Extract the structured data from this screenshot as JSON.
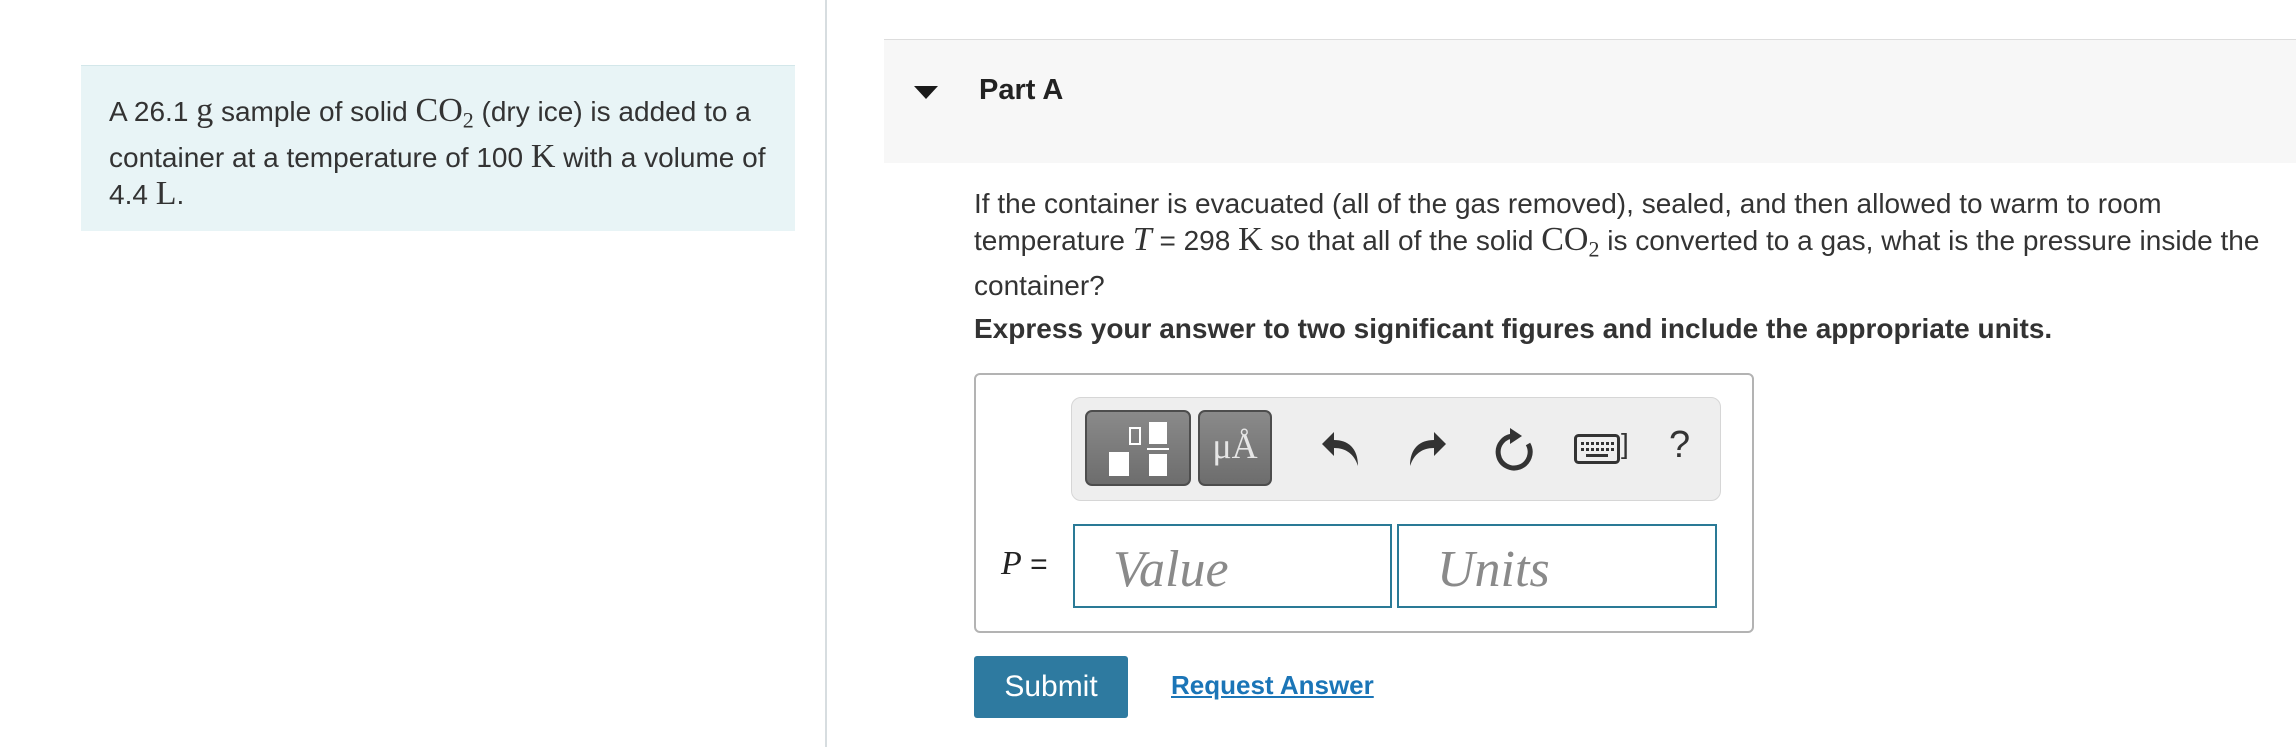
{
  "intro": {
    "t1": "A 26.1 ",
    "mass_unit": "g",
    "t2": " sample of solid ",
    "co2_base": "CO",
    "co2_sub": "2",
    "t3": " (dry ice) is added to a container at a temperature of 100 ",
    "temp_unit": "K",
    "t4": " with a volume of 4.4 ",
    "vol_unit": "L",
    "t5": "."
  },
  "part": {
    "title": "Part A"
  },
  "question": {
    "q1": "If the container is evacuated (all of the gas removed), sealed, and then allowed to warm to room temperature ",
    "T_var": "T",
    "q2": " = 298 ",
    "K_unit": "K",
    "q3": " so that all of the solid ",
    "co2_base": "CO",
    "co2_sub": "2",
    "q4": " is converted to a gas, what is the pressure inside the container?"
  },
  "instruction": "Express your answer to two significant figures and include the appropriate units.",
  "toolbar": {
    "units_symbol": "μÅ",
    "help": "?",
    "kbd_bracket": "]"
  },
  "answer": {
    "var": "P",
    "eq": " =",
    "value_placeholder": "Value",
    "units_placeholder": "Units"
  },
  "actions": {
    "submit": "Submit",
    "request": "Request Answer"
  }
}
